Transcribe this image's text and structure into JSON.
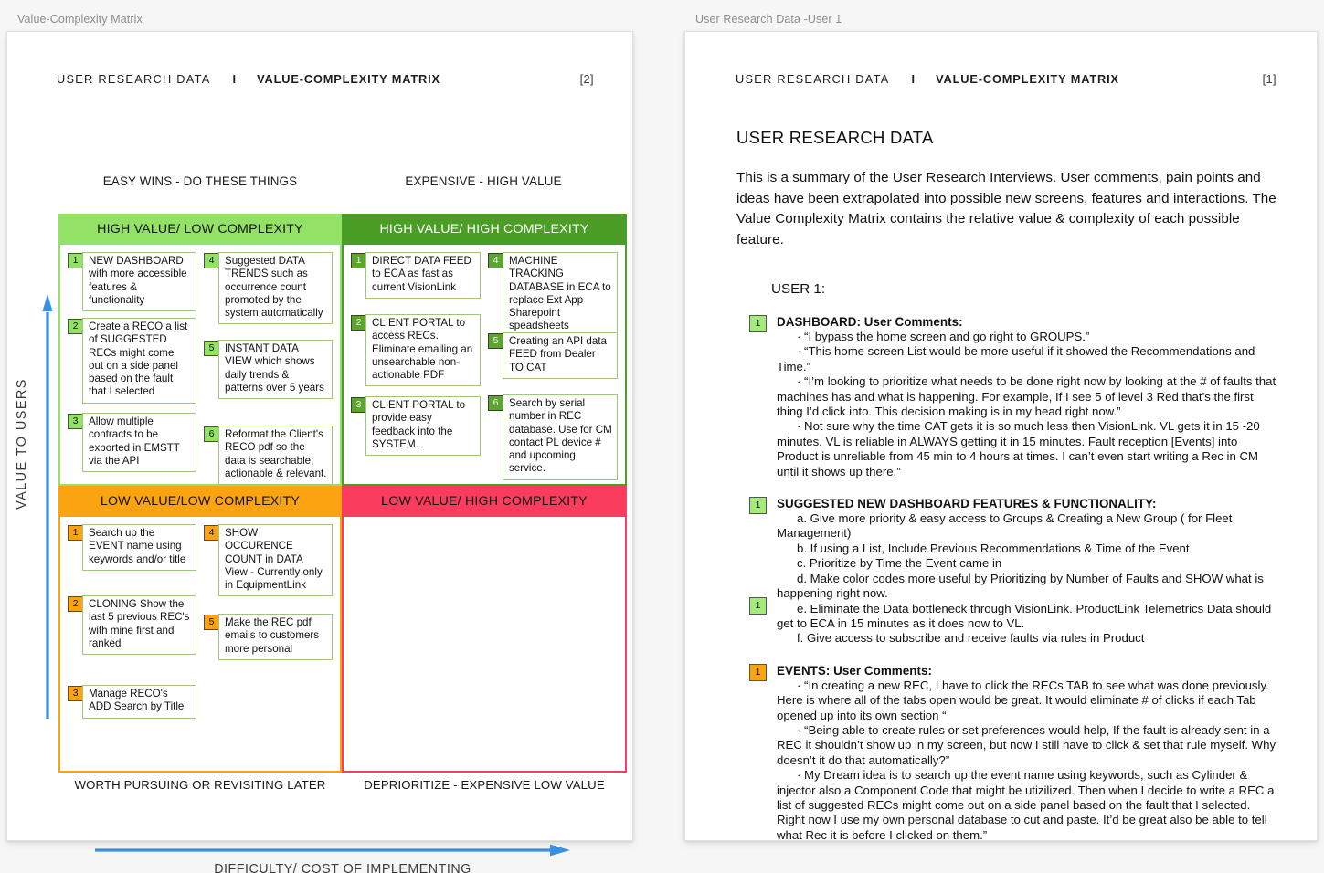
{
  "left_panel": {
    "caption": "Value-Complexity Matrix",
    "header": {
      "left": "USER RESEARCH DATA",
      "sep": "I",
      "mid": "VALUE-COMPLEXITY MATRIX",
      "num": "[2]"
    },
    "top_captions": {
      "left": "EASY WINS - DO THESE THINGS",
      "right": "EXPENSIVE - HIGH VALUE"
    },
    "bottom_captions": {
      "left": "WORTH PURSUING OR REVISITING LATER",
      "right": "DEPRIORITIZE - EXPENSIVE LOW VALUE"
    },
    "y_axis": "VALUE TO USERS",
    "x_axis": "DIFFICULTY/ COST OF IMPLEMENTING",
    "quadrants": [
      {
        "key": "high-value-low-complexity",
        "title": "HIGH VALUE/ LOW COMPLEXITY",
        "header_color": "#93e167",
        "badge_style": "badge-green",
        "left_items": [
          {
            "n": "1",
            "text": "NEW DASHBOARD with more accessible features & functionality"
          },
          {
            "n": "2",
            "text": "Create a RECO a list of SUGGESTED RECs might come out on a side panel based on the fault that I selected"
          },
          {
            "n": "3",
            "text": "Allow multiple contracts to be exported in EMSTT via the API"
          }
        ],
        "right_items": [
          {
            "n": "4",
            "text": "Suggested DATA TRENDS such as occurrence count promoted by the system automatically"
          },
          {
            "n": "5",
            "text": "INSTANT DATA VIEW which shows daily trends & patterns over 5 years"
          },
          {
            "n": "6",
            "text": "Reformat the Client's RECO pdf so the data is searchable, actionable & relevant."
          }
        ]
      },
      {
        "key": "high-value-high-complexity",
        "title": "HIGH VALUE/ HIGH COMPLEXITY",
        "header_color": "#4a9e26",
        "badge_style": "badge-dgreen",
        "left_items": [
          {
            "n": "1",
            "text": "DIRECT DATA FEED to ECA as fast as current VisionLink"
          },
          {
            "n": "2",
            "text": "CLIENT PORTAL to access RECs. Eliminate emailing an unsearchable non-actionable PDF"
          },
          {
            "n": "3",
            "text": "CLIENT PORTAL to provide easy feedback into the SYSTEM."
          }
        ],
        "right_items": [
          {
            "n": "4",
            "text": "MACHINE TRACKING DATABASE in ECA to replace Ext App Sharepoint speadsheets"
          },
          {
            "n": "5",
            "text": "Creating an API data FEED from Dealer TO CAT"
          },
          {
            "n": "6",
            "text": "Search by serial number in REC database. Use for CM contact PL device # and upcoming service."
          }
        ]
      },
      {
        "key": "low-value-low-complexity",
        "title": "LOW VALUE/LOW COMPLEXITY",
        "header_color": "#fca311",
        "badge_style": "badge-orange",
        "left_items": [
          {
            "n": "1",
            "text": "Search up the EVENT name using keywords and/or title"
          },
          {
            "n": "2",
            "text": "CLONING Show the last 5 previous REC's with mine first and ranked"
          },
          {
            "n": "3",
            "text": "Manage RECO's ADD Search by Title"
          }
        ],
        "right_items": [
          {
            "n": "4",
            "text": "SHOW OCCURENCE COUNT in DATA View - Currently only in EquipmentLink"
          },
          {
            "n": "5",
            "text": "Make the REC pdf emails to customers more personal"
          }
        ]
      },
      {
        "key": "low-value-high-complexity",
        "title": "LOW VALUE/ HIGH COMPLEXITY",
        "header_color": "#fa3c5f",
        "badge_style": "badge-orange",
        "left_items": [],
        "right_items": []
      }
    ]
  },
  "right_panel": {
    "caption": "User Research Data -User 1",
    "header": {
      "left": "USER RESEARCH DATA",
      "sep": "I",
      "mid": "VALUE-COMPLEXITY MATRIX",
      "num": "[1]"
    },
    "title": "USER RESEARCH DATA",
    "intro": "This is a summary of the User Research Interviews. User comments, pain points and ideas have been extrapolated into possible new screens, features and interactions. The Value Complexity Matrix contains the relative value & complexity of each possible feature.",
    "user_label": "USER 1:",
    "sections": [
      {
        "key": "dashboard-user-comments",
        "badge": "1",
        "badge_color": "green",
        "heading": "DASHBOARD: User Comments:",
        "paragraphs": [
          "· “I bypass the home screen and go right to GROUPS.”",
          "· “This home screen List would be more useful if it showed the Recommendations and Time.”",
          "· “I’m looking to prioritize what needs to be done right now by looking at the # of faults that machines has and what is happening. For example, If I see 5 of level 3 Red that’s the first thing I’d click into. This decision making is in my head right now.”",
          "· Not sure why the time CAT gets it is so much less then VisionLink. VL gets it in 15 -20 minutes. VL is reliable in ALWAYS getting it in 15 minutes. Fault reception [Events] into Product is unreliable from 45 min to 4 hours at times. I can’t even start writing a Rec in CM until it shows up there.”"
        ]
      },
      {
        "key": "suggested-new-dashboard-features",
        "badge": "1",
        "badge_color": "green",
        "badge2": "1",
        "badge2_color": "green",
        "heading": "SUGGESTED NEW DASHBOARD FEATURES & FUNCTIONALITY:",
        "paragraphs": [
          "a. Give more priority & easy access to Groups & Creating a New Group ( for Fleet Management)",
          "b. If using a List, Include Previous Recommendations & Time of the Event",
          "c. Prioritize by Time the Event came in",
          "d. Make color codes more useful by Prioritizing by Number of Faults and SHOW what is happening right now.",
          "e. Eliminate the Data bottleneck through VisionLink. ProductLink Telemetrics Data should get to ECA in 15 minutes as it does now to VL.",
          "f. Give access to subscribe and receive faults via rules in Product"
        ]
      },
      {
        "key": "events-user-comments",
        "badge": "1",
        "badge_color": "orange",
        "heading": "EVENTS: User Comments:",
        "paragraphs": [
          "· “In creating a new REC, I have to click the RECs TAB to see what was done previously. Here is where all of the tabs open would be great. It would eliminate # of clicks if each Tab opened up into its own section “",
          "· “Being able to create rules or set preferences would help, If the fault is already sent in a REC it shouldn’t show up in my screen, but now I still have to click & set that rule myself. Why doesn’t it do that automatically?”",
          "· My Dream idea is to search up the event name using keywords, such as Cylinder & injector also a Component Code that might be utizilized. Then when I decide to write a REC a list of suggested RECs might come out on a side panel based on the fault that I selected. Right now I use my own personal database to cut and paste. It’d be great also be able to tell what Rec it is before I clicked on them.”"
        ]
      }
    ]
  },
  "colors": {
    "accent_blue": "#3b8fe0",
    "green_light": "#93e167",
    "green_dark": "#4a9e26",
    "orange": "#fca311",
    "pink": "#fa3c5f"
  }
}
